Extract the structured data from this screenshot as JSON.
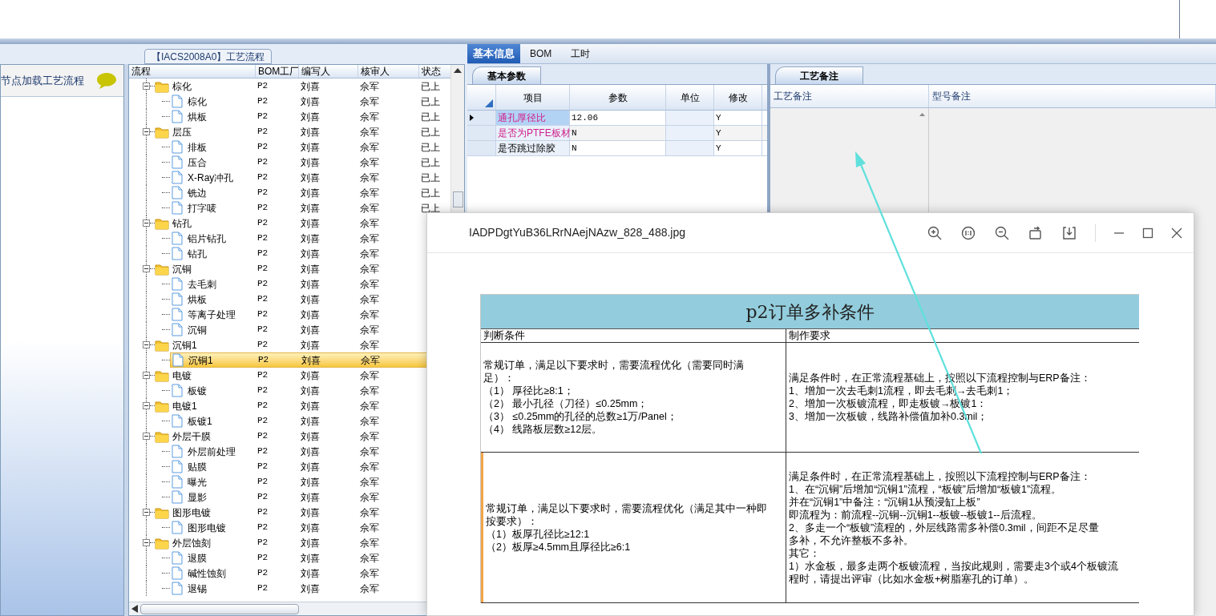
{
  "left_pane": {
    "hint": "节点加载工艺流程"
  },
  "process_group": {
    "title": "【IACS2008A0】工艺流程"
  },
  "tree_grid": {
    "columns": [
      "流程",
      "BOM工厂",
      "编写人",
      "核审人",
      "状态"
    ],
    "rows": [
      {
        "name": "棕化",
        "factory": "P2",
        "author": "刘喜",
        "reviewer": "佘军",
        "status": "已上",
        "expanded": true,
        "selected": false,
        "children": [
          {
            "name": "棕化",
            "factory": "P2",
            "author": "刘喜",
            "reviewer": "佘军",
            "status": "已上",
            "selected": false
          },
          {
            "name": "烘板",
            "factory": "P2",
            "author": "刘喜",
            "reviewer": "佘军",
            "status": "已上",
            "selected": false
          }
        ]
      },
      {
        "name": "层压",
        "factory": "P2",
        "author": "刘喜",
        "reviewer": "佘军",
        "status": "已上",
        "expanded": true,
        "selected": false,
        "children": [
          {
            "name": "排板",
            "factory": "P2",
            "author": "刘喜",
            "reviewer": "佘军",
            "status": "已上",
            "selected": false
          },
          {
            "name": "压合",
            "factory": "P2",
            "author": "刘喜",
            "reviewer": "佘军",
            "status": "已上",
            "selected": false
          },
          {
            "name": "X-Ray冲孔",
            "factory": "P2",
            "author": "刘喜",
            "reviewer": "佘军",
            "status": "已上",
            "selected": false
          },
          {
            "name": "铣边",
            "factory": "P2",
            "author": "刘喜",
            "reviewer": "佘军",
            "status": "已上",
            "selected": false
          },
          {
            "name": "打字唛",
            "factory": "P2",
            "author": "刘喜",
            "reviewer": "佘军",
            "status": "已上",
            "selected": false
          }
        ]
      },
      {
        "name": "钻孔",
        "factory": "P2",
        "author": "刘喜",
        "reviewer": "佘军",
        "expanded": true,
        "selected": false,
        "children": [
          {
            "name": "铝片钻孔",
            "factory": "P2",
            "author": "刘喜",
            "reviewer": "佘军",
            "selected": false
          },
          {
            "name": "钻孔",
            "factory": "P2",
            "author": "刘喜",
            "reviewer": "佘军",
            "selected": false
          }
        ]
      },
      {
        "name": "沉铜",
        "factory": "P2",
        "author": "刘喜",
        "reviewer": "佘军",
        "expanded": true,
        "selected": false,
        "children": [
          {
            "name": "去毛刺",
            "factory": "P2",
            "author": "刘喜",
            "reviewer": "佘军",
            "selected": false
          },
          {
            "name": "烘板",
            "factory": "P2",
            "author": "刘喜",
            "reviewer": "佘军",
            "selected": false
          },
          {
            "name": "等离子处理",
            "factory": "P2",
            "author": "刘喜",
            "reviewer": "佘军",
            "selected": false
          },
          {
            "name": "沉铜",
            "factory": "P2",
            "author": "刘喜",
            "reviewer": "佘军",
            "selected": false
          }
        ]
      },
      {
        "name": "沉铜1",
        "factory": "P2",
        "author": "刘喜",
        "reviewer": "佘军",
        "expanded": true,
        "selected": false,
        "children": [
          {
            "name": "沉铜1",
            "factory": "P2",
            "author": "刘喜",
            "reviewer": "佘军",
            "selected": true
          }
        ]
      },
      {
        "name": "电镀",
        "factory": "P2",
        "author": "刘喜",
        "reviewer": "佘军",
        "expanded": true,
        "selected": false,
        "children": [
          {
            "name": "板镀",
            "factory": "P2",
            "author": "刘喜",
            "reviewer": "佘军",
            "selected": false
          }
        ]
      },
      {
        "name": "电镀1",
        "factory": "P2",
        "author": "刘喜",
        "reviewer": "佘军",
        "expanded": true,
        "selected": false,
        "children": [
          {
            "name": "板镀1",
            "factory": "P2",
            "author": "刘喜",
            "reviewer": "佘军",
            "selected": false
          }
        ]
      },
      {
        "name": "外层干膜",
        "factory": "P2",
        "author": "刘喜",
        "reviewer": "佘军",
        "expanded": true,
        "selected": false,
        "children": [
          {
            "name": "外层前处理",
            "factory": "P2",
            "author": "刘喜",
            "reviewer": "佘军",
            "selected": false
          },
          {
            "name": "贴膜",
            "factory": "P2",
            "author": "刘喜",
            "reviewer": "佘军",
            "selected": false
          },
          {
            "name": "曝光",
            "factory": "P2",
            "author": "刘喜",
            "reviewer": "佘军",
            "selected": false
          },
          {
            "name": "显影",
            "factory": "P2",
            "author": "刘喜",
            "reviewer": "佘军",
            "selected": false
          }
        ]
      },
      {
        "name": "图形电镀",
        "factory": "P2",
        "author": "刘喜",
        "reviewer": "佘军",
        "expanded": true,
        "selected": false,
        "children": [
          {
            "name": "图形电镀",
            "factory": "P2",
            "author": "刘喜",
            "reviewer": "佘军",
            "selected": false
          }
        ]
      },
      {
        "name": "外层蚀刻",
        "factory": "P2",
        "author": "刘喜",
        "reviewer": "佘军",
        "expanded": true,
        "selected": false,
        "children": [
          {
            "name": "退膜",
            "factory": "P2",
            "author": "刘喜",
            "reviewer": "佘军",
            "selected": false
          },
          {
            "name": "碱性蚀刻",
            "factory": "P2",
            "author": "刘喜",
            "reviewer": "佘军",
            "selected": false
          },
          {
            "name": "退锡",
            "factory": "P2",
            "author": "刘喜",
            "reviewer": "佘军",
            "selected": false
          }
        ]
      }
    ]
  },
  "tabs": [
    {
      "label": "基本信息",
      "selected": true
    },
    {
      "label": "BOM",
      "selected": false
    },
    {
      "label": "工时",
      "selected": false
    }
  ],
  "params": {
    "tab": "基本参数",
    "columns": [
      "项目",
      "参数",
      "单位",
      "修改"
    ],
    "rows": [
      {
        "item": "通孔厚径比",
        "value": "12.06",
        "modify": "Y",
        "highlight": true,
        "current": true
      },
      {
        "item": "是否为PTFE板材",
        "value": "N",
        "modify": "Y",
        "highlight": true,
        "current": false
      },
      {
        "item": "是否跳过除胶",
        "value": "N",
        "modify": "Y",
        "highlight": false,
        "current": false
      }
    ]
  },
  "notes": {
    "tab": "工艺备注",
    "columns": [
      "工艺备注",
      "型号备注"
    ]
  },
  "viewer": {
    "title": "IADPDgtYuB36LRrNAejNAzw_828_488.jpg",
    "sheet": {
      "title": "p2订单多补条件",
      "columns": [
        "判断条件",
        "制作要求"
      ],
      "rows": [
        {
          "condition": [
            "常规订单，满足以下要求时，需要流程优化（需要同时满",
            "足）：",
            "（1） 厚径比≥8:1；",
            "（2） 最小孔径（刀径）≤0.25mm；",
            "（3） ≤0.25mm的孔径的总数≥1万/Panel；",
            "（4） 线路板层数≥12层。"
          ],
          "requirement": [
            "满足条件时，在正常流程基础上，按照以下流程控制与ERP备注：",
            "1、增加一次去毛刺1流程，即去毛刺→去毛刺1；",
            "2、增加一次板镀流程，即走板镀→板镀1：",
            "3、增加一次板镀，线路补偿值加补0.3mil；"
          ],
          "marked": false
        },
        {
          "condition": [
            "常规订单，满足以下要求时，需要流程优化（满足其中一种即",
            "按要求）：",
            "（1）板厚孔径比≥12:1",
            "（2）板厚≥4.5mm且厚径比≥6:1"
          ],
          "requirement": [
            "满足条件时，在正常流程基础上，按照以下流程控制与ERP备注：",
            "1、在“沉铜”后增加“沉铜1”流程，“板镀”后增加“板镀1”流程。",
            "并在“沉铜1”中备注：“沉铜1从预浸缸上板”",
            "即流程为：前流程--沉铜--沉铜1--板镀--板镀1--后流程。",
            "2、多走一个“板镀”流程的，外层线路需多补偿0.3mil，间距不足尽量",
            "多补，不允许整板不多补。",
            "其它：",
            "1）水金板，最多走两个板镀流程，当按此规则，需要走3个或4个板镀流",
            "程时，请提出评审（比如水金板+树脂塞孔的订单）。"
          ],
          "marked": true
        }
      ]
    }
  }
}
